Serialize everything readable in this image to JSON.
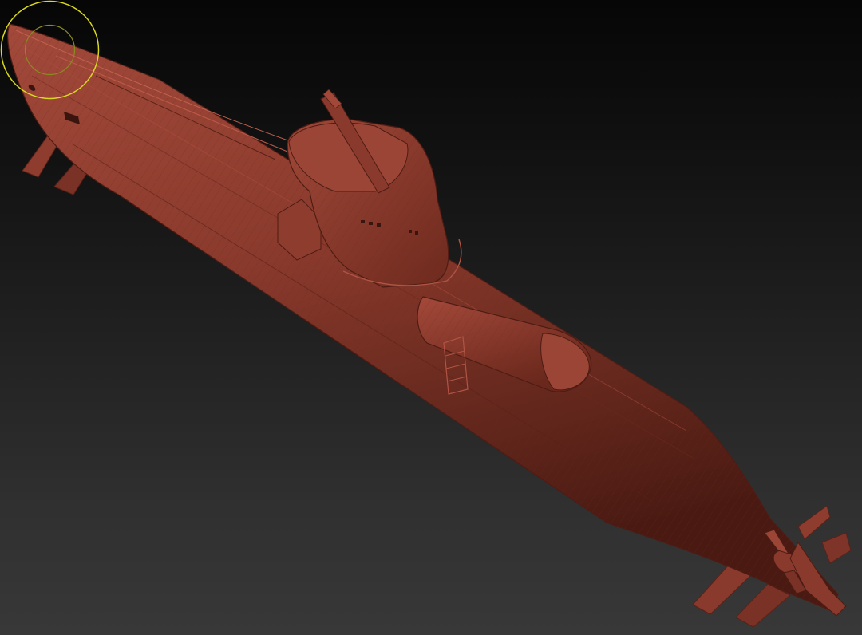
{
  "viewport": {
    "background_top": "#060606",
    "background_bottom": "#383838"
  },
  "model": {
    "name": "submarine",
    "material_color": "#8a3a2c",
    "highlight_color": "#a2493a",
    "shadow_color": "#4a1a12",
    "wireframe_color": "#6a2a1e"
  },
  "brush_cursor": {
    "outer_ring_color": "#d8d820",
    "inner_ring_color": "#8a8a20"
  }
}
